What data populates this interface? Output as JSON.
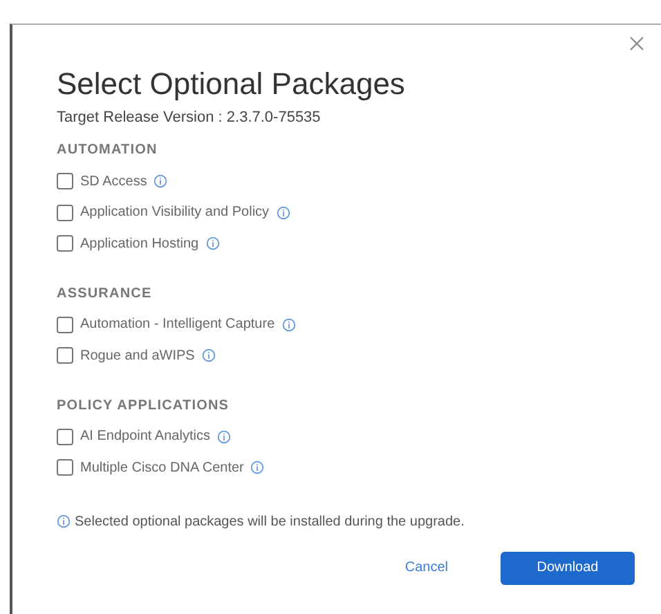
{
  "dialog": {
    "title": "Select Optional Packages",
    "subtitle": "Target Release Version : 2.3.7.0-75535",
    "sections": [
      {
        "heading": "AUTOMATION",
        "packages": [
          {
            "label": "SD Access",
            "checked": false
          },
          {
            "label": "Application Visibility and Policy",
            "checked": false
          },
          {
            "label": "Application Hosting",
            "checked": false
          }
        ]
      },
      {
        "heading": "ASSURANCE",
        "packages": [
          {
            "label": "Automation - Intelligent Capture",
            "checked": false
          },
          {
            "label": "Rogue and aWIPS",
            "checked": false
          }
        ]
      },
      {
        "heading": "POLICY APPLICATIONS",
        "packages": [
          {
            "label": "AI Endpoint Analytics",
            "checked": false
          },
          {
            "label": "Multiple Cisco DNA Center",
            "checked": false
          }
        ]
      }
    ],
    "note": "Selected optional packages will be installed during the upgrade.",
    "buttons": [
      {
        "label": "Cancel",
        "kind": "link"
      },
      {
        "label": "Download",
        "kind": "primary"
      }
    ]
  }
}
